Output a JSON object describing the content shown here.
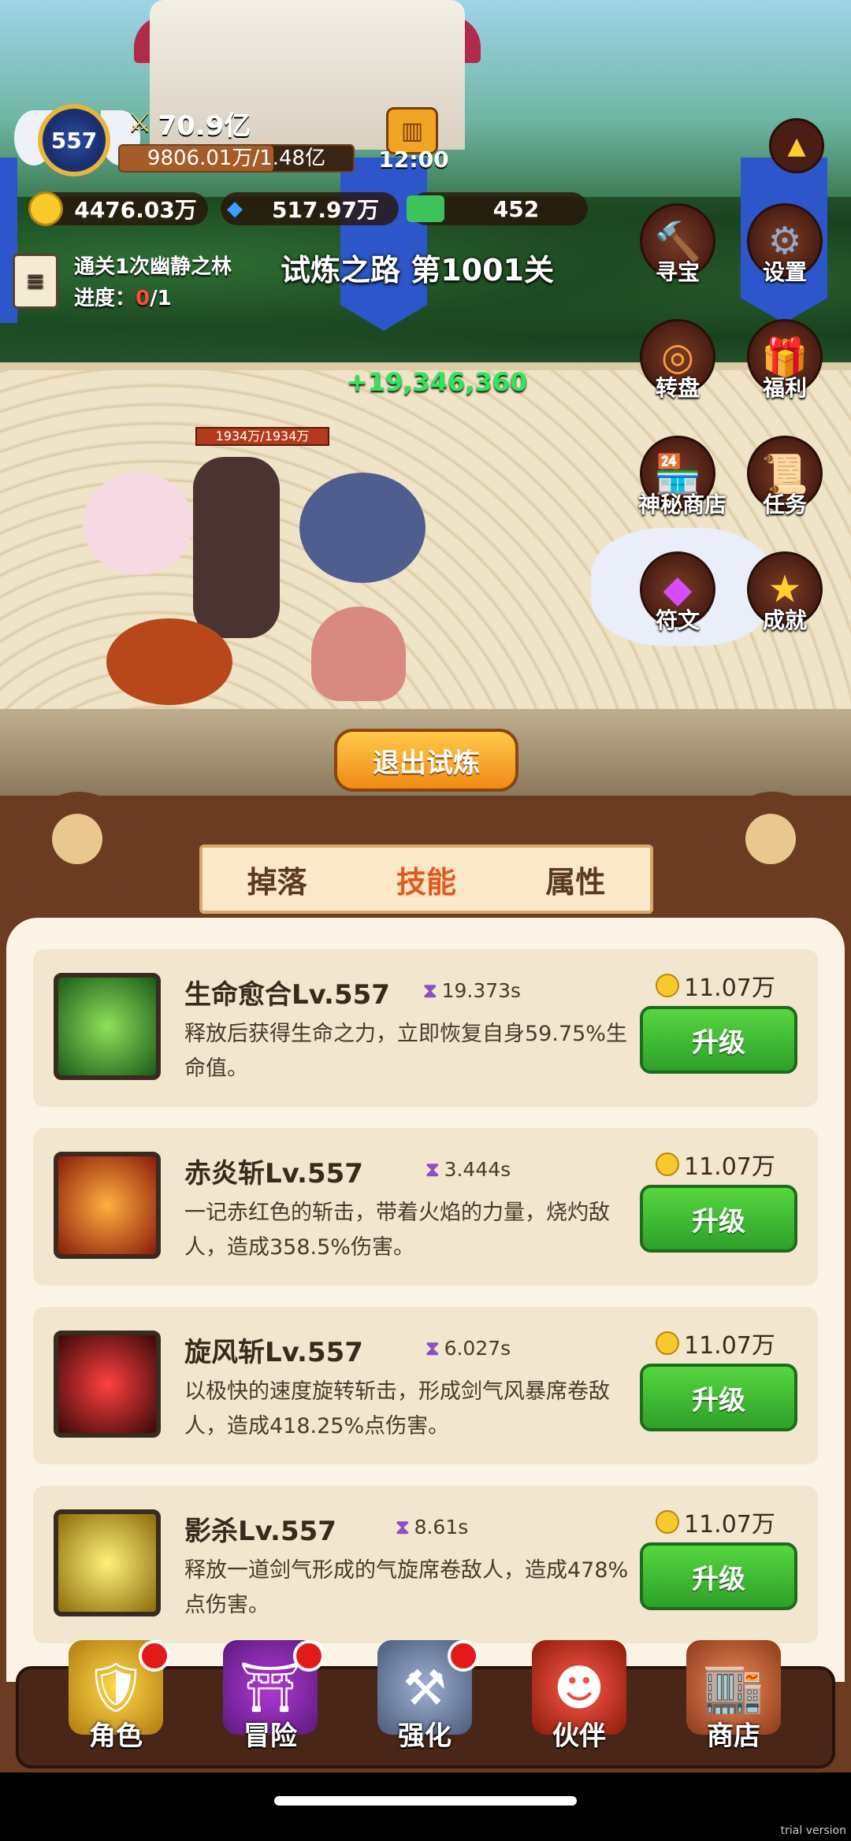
{
  "hud": {
    "level": "557",
    "power": "70.9亿",
    "exp_text": "9806.01万/1.48亿",
    "exp_fraction": 0.66,
    "timer": "12:00",
    "gold": "4476.03万",
    "diamond": "517.97万",
    "cash": "452"
  },
  "quest": {
    "title": "通关1次幽静之林",
    "progress_label": "进度：",
    "progress_current": "0",
    "progress_total": "/1"
  },
  "stage_title": "试炼之路 第1001关",
  "gain_text": "+19,346,360",
  "hero_hp": "1934万/1934万",
  "side_buttons": {
    "treasure": "寻宝",
    "settings": "设置",
    "wheel": "转盘",
    "welfare": "福利",
    "mystery_shop": "神秘商店",
    "tasks": "任务",
    "runes": "符文",
    "achievements": "成就"
  },
  "exit_button": "退出试炼",
  "tabs": [
    "掉落",
    "技能",
    "属性"
  ],
  "skills": [
    {
      "name": "生命愈合Lv.557",
      "cd": "19.373s",
      "desc": "释放后获得生命之力，立即恢复自身59.75%生命值。",
      "cost": "11.07万",
      "btn": "升级"
    },
    {
      "name": "赤炎斩Lv.557",
      "cd": "3.444s",
      "desc": "一记赤红色的斩击，带着火焰的力量，烧灼敌人，造成358.5%伤害。",
      "cost": "11.07万",
      "btn": "升级"
    },
    {
      "name": "旋风斩Lv.557",
      "cd": "6.027s",
      "desc": "以极快的速度旋转斩击，形成剑气风暴席卷敌人，造成418.25%点伤害。",
      "cost": "11.07万",
      "btn": "升级"
    },
    {
      "name": "影杀Lv.557",
      "cd": "8.61s",
      "desc": "释放一道剑气形成的气旋席卷敌人，造成478%点伤害。",
      "cost": "11.07万",
      "btn": "升级"
    }
  ],
  "nav": [
    "角色",
    "冒险",
    "强化",
    "伙伴",
    "商店"
  ],
  "watermark": "trial version",
  "colors": {
    "upgrade_green": "#3dbb33",
    "active_tab": "#e05a1e",
    "gain_green": "#2ee65a"
  }
}
